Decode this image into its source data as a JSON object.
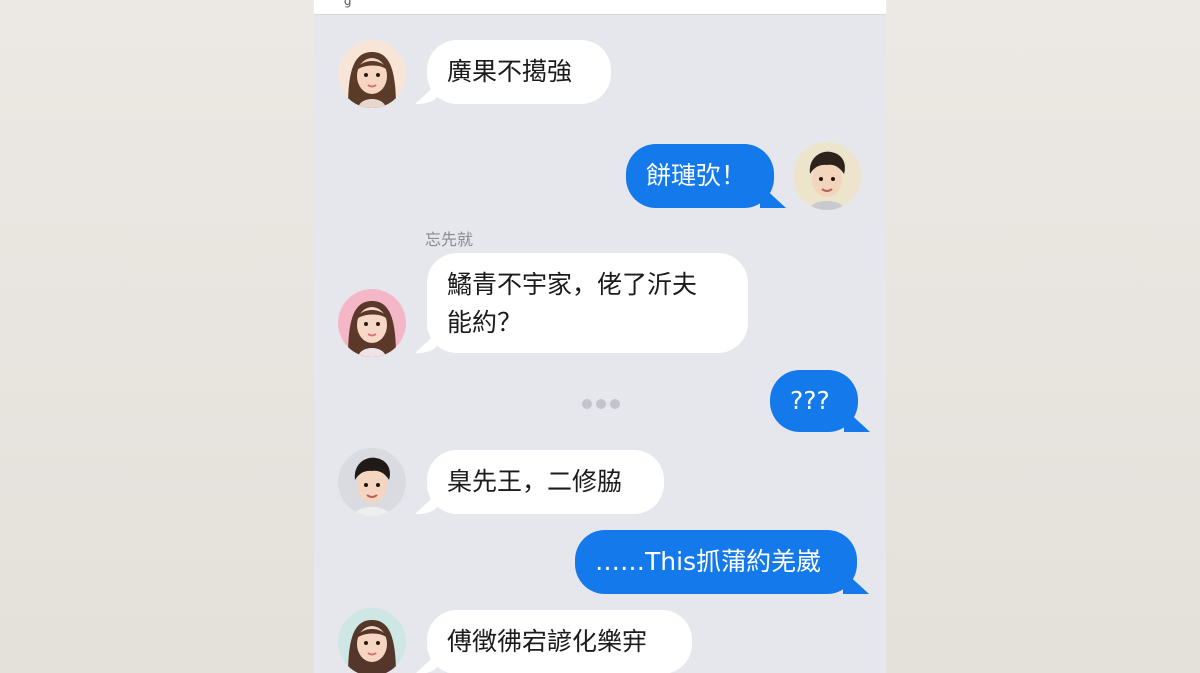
{
  "colors": {
    "incoming_bubble": "#ffffff",
    "outgoing_bubble": "#1479ea",
    "chat_background": "#e6e7ec",
    "outer_background": "#e7e3dd"
  },
  "header": {
    "partial_glyph": "’g"
  },
  "messages": [
    {
      "side": "incoming",
      "avatar": "female-avatar",
      "text": "廣果不擖強"
    },
    {
      "side": "outgoing",
      "avatar": "male-avatar",
      "text": "餅璉弞！"
    },
    {
      "side": "incoming",
      "avatar": "female-avatar",
      "sender": "忘先就",
      "lines": [
        "鱊青不宇家，佬了沂夫",
        "能約？"
      ]
    },
    {
      "side": "outgoing",
      "text": "???"
    },
    {
      "side": "incoming",
      "avatar": "male-avatar",
      "text": "臬先王，二修脇"
    },
    {
      "side": "outgoing",
      "text": "……This抓蒲約羌崴"
    },
    {
      "side": "incoming",
      "avatar": "female-avatar",
      "text": "傅徴彿宕諺化樂宑"
    }
  ],
  "typing_indicator": {
    "icon": "typing-dots-icon"
  }
}
